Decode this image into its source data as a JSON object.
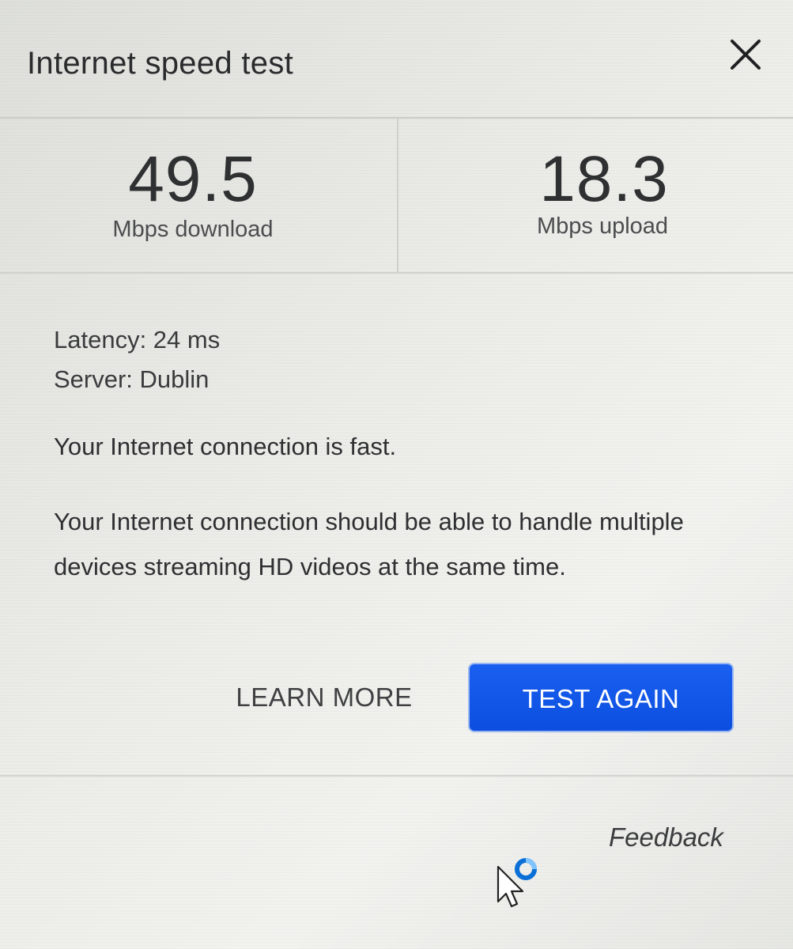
{
  "dialog": {
    "title": "Internet speed test",
    "close_icon": "close-icon"
  },
  "results": {
    "download": {
      "value": "49.5",
      "label": "Mbps download"
    },
    "upload": {
      "value": "18.3",
      "label": "Mbps upload"
    }
  },
  "details": {
    "latency": "Latency: 24 ms",
    "server": "Server: Dublin"
  },
  "status_text": "Your Internet connection is fast.",
  "description_text": "Your Internet connection should be able to handle multiple devices streaming HD videos at the same time.",
  "actions": {
    "learn_more": "LEARN MORE",
    "test_again": "TEST AGAIN"
  },
  "footer": {
    "feedback": "Feedback"
  },
  "colors": {
    "primary_button": "#1a5ff0",
    "text": "#2e2f31"
  },
  "icons": {
    "cursor": "busy-cursor-icon"
  }
}
